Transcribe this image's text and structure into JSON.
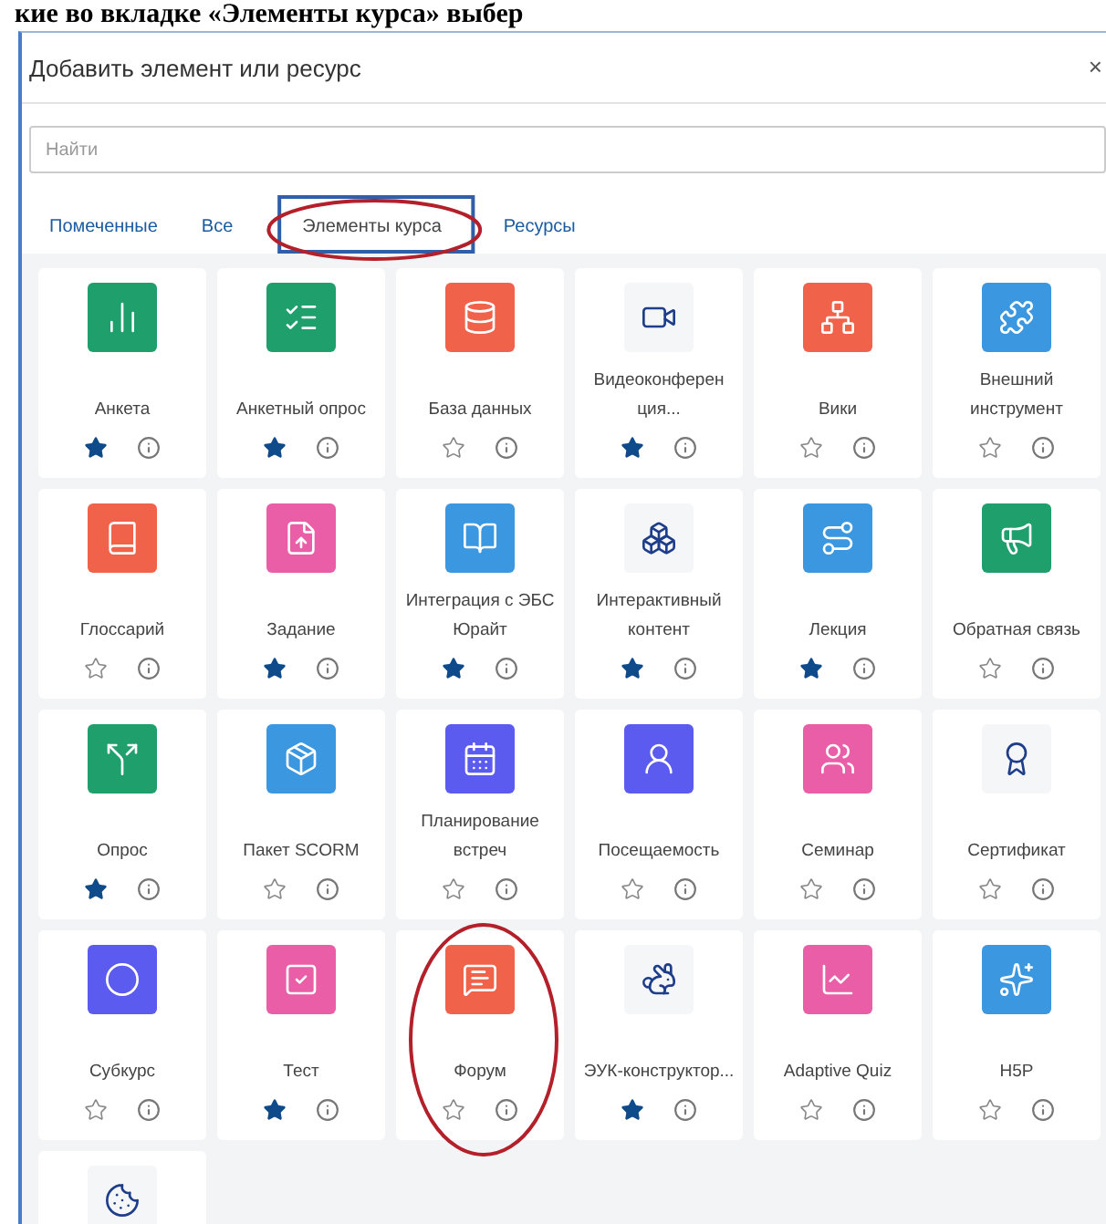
{
  "heading": "кие во вкладке «Элементы курса» выбер",
  "dialog": {
    "title": "Добавить элемент или ресурс",
    "close": "×"
  },
  "search": {
    "placeholder": "Найти"
  },
  "tabs": [
    {
      "label": "Помеченные",
      "selected": false
    },
    {
      "label": "Все",
      "selected": false
    },
    {
      "label": "Элементы курса",
      "selected": true
    },
    {
      "label": "Ресурсы",
      "selected": false
    }
  ],
  "items": [
    {
      "label": "Анкета",
      "starred": true,
      "color": "#1e9f6c"
    },
    {
      "label": "Анкетный опрос",
      "starred": true,
      "color": "#1e9f6c"
    },
    {
      "label": "База данных",
      "starred": false,
      "color": "#f0624a"
    },
    {
      "label": "Видеоконферен ция...",
      "starred": true,
      "color": "#f5f6f7"
    },
    {
      "label": "Вики",
      "starred": false,
      "color": "#f0624a"
    },
    {
      "label": "Внешний инструмент",
      "starred": false,
      "color": "#3b97e0"
    },
    {
      "label": "Глоссарий",
      "starred": false,
      "color": "#f0624a"
    },
    {
      "label": "Задание",
      "starred": true,
      "color": "#e95ea7"
    },
    {
      "label": "Интеграция с ЭБС Юрайт",
      "starred": true,
      "color": "#3b97e0"
    },
    {
      "label": "Интерактивный контент",
      "starred": true,
      "color": "#f5f6f7"
    },
    {
      "label": "Лекция",
      "starred": true,
      "color": "#3b97e0"
    },
    {
      "label": "Обратная связь",
      "starred": false,
      "color": "#1e9f6c"
    },
    {
      "label": "Опрос",
      "starred": true,
      "color": "#1e9f6c"
    },
    {
      "label": "Пакет SCORM",
      "starred": false,
      "color": "#3b97e0"
    },
    {
      "label": "Планирование встреч",
      "starred": false,
      "color": "#5b5bf0"
    },
    {
      "label": "Посещаемость",
      "starred": false,
      "color": "#5b5bf0"
    },
    {
      "label": "Семинар",
      "starred": false,
      "color": "#e95ea7"
    },
    {
      "label": "Сертификат",
      "starred": false,
      "color": "#f5f6f7"
    },
    {
      "label": "Субкурс",
      "starred": false,
      "color": "#5b5bf0"
    },
    {
      "label": "Тест",
      "starred": true,
      "color": "#e95ea7"
    },
    {
      "label": "Форум",
      "starred": false,
      "color": "#f0624a"
    },
    {
      "label": "ЭУК-конструктор...",
      "starred": true,
      "color": "#f5f6f7"
    },
    {
      "label": "Adaptive Quiz",
      "starred": false,
      "color": "#e95ea7"
    },
    {
      "label": "H5P",
      "starred": false,
      "color": "#3b97e0"
    },
    {
      "color": "#f5f6f7"
    }
  ]
}
